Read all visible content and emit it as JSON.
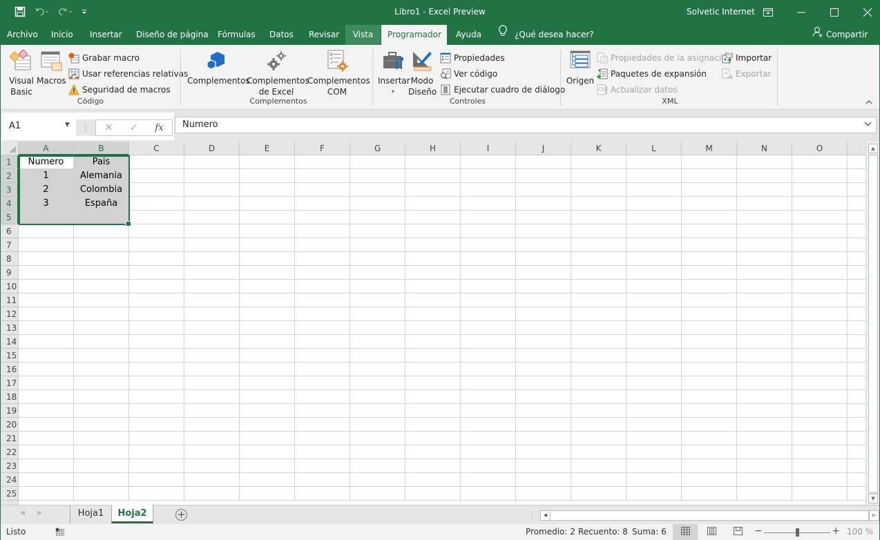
{
  "titlebar": {
    "title": "Libro1  -  Excel Preview",
    "account": "Solvetic Internet",
    "qat": {
      "save": "save-icon",
      "undo": "undo-icon",
      "redo": "redo-icon",
      "customize": "customize-qat-icon"
    }
  },
  "menu": {
    "tabs": [
      {
        "label": "Archivo"
      },
      {
        "label": "Inicio"
      },
      {
        "label": "Insertar"
      },
      {
        "label": "Diseño de página"
      },
      {
        "label": "Fórmulas"
      },
      {
        "label": "Datos"
      },
      {
        "label": "Revisar"
      },
      {
        "label": "Vista"
      },
      {
        "label": "Programador"
      },
      {
        "label": "Ayuda"
      }
    ],
    "active_tab": "Programador",
    "tell_me": "¿Qué desea hacer?",
    "share": "Compartir"
  },
  "ribbon": {
    "codigo": {
      "label": "Código",
      "visual_basic": "Visual Basic",
      "visual_basic_l1": "Visual",
      "visual_basic_l2": "Basic",
      "macros": "Macros",
      "grabar_macro": "Grabar macro",
      "usar_referencias": "Usar referencias relativas",
      "seguridad": "Seguridad de macros"
    },
    "complementos": {
      "label": "Complementos",
      "complementos": "Complementos",
      "excel_l1": "Complementos",
      "excel_l2": "de Excel",
      "com_l1": "Complementos",
      "com_l2": "COM"
    },
    "controles": {
      "label": "Controles",
      "insertar": "Insertar",
      "modo_l1": "Modo",
      "modo_l2": "Diseño",
      "propiedades": "Propiedades",
      "ver_codigo": "Ver código",
      "ejecutar": "Ejecutar cuadro de diálogo"
    },
    "xml": {
      "label": "XML",
      "origen": "Origen",
      "propiedades_asignacion": "Propiedades de la asignación",
      "paquetes": "Paquetes de expansión",
      "actualizar": "Actualizar datos",
      "importar": "Importar",
      "exportar": "Exportar"
    }
  },
  "formula_bar": {
    "name_box": "A1",
    "formula": "Numero",
    "fx_label": "fx"
  },
  "grid": {
    "columns": [
      "A",
      "B",
      "C",
      "D",
      "E",
      "F",
      "G",
      "H",
      "I",
      "J",
      "K",
      "L",
      "M",
      "N",
      "O"
    ],
    "selected_columns": [
      "A",
      "B"
    ],
    "rows": [
      1,
      2,
      3,
      4,
      5,
      6,
      7,
      8,
      9,
      10,
      11,
      12,
      13,
      14,
      15,
      16,
      17,
      18,
      19,
      20,
      21,
      22,
      23,
      24,
      25
    ],
    "selected_rows": [
      1,
      2,
      3,
      4,
      5
    ],
    "selection": "A1:B5",
    "cells": {
      "A1": "Numero",
      "B1": "Pais",
      "A2": "1",
      "B2": "Alemania",
      "A3": "2",
      "B3": "Colombia",
      "A4": "3",
      "B4": "España"
    }
  },
  "sheets": {
    "tabs": [
      "Hoja1",
      "Hoja2"
    ],
    "active": "Hoja2",
    "add_icon": "+"
  },
  "status": {
    "ready": "Listo",
    "promedio": "Promedio: 2",
    "recuento": "Recuento: 8",
    "suma": "Suma: 6",
    "zoom": "100 %",
    "zoom_percent": 100
  },
  "colors": {
    "brand": "#217346",
    "ribbon_bg": "#f3f3f3",
    "selection_fill": "#d2d2d2"
  }
}
